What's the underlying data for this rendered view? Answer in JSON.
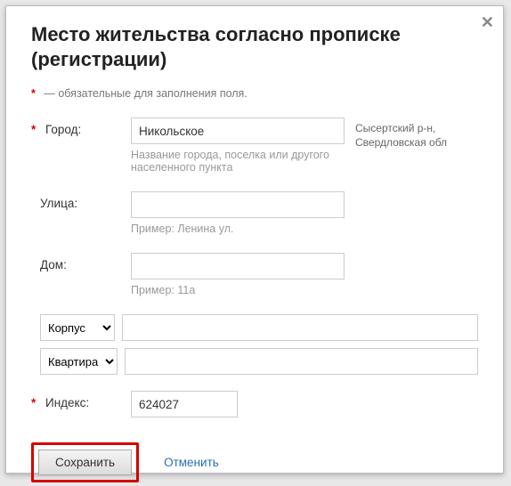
{
  "title": "Место жительства согласно прописке (регистрации)",
  "required_note": "— обязательные для заполнения поля.",
  "labels": {
    "city": "Город:",
    "street": "Улица:",
    "house": "Дом:",
    "index": "Индекс:"
  },
  "values": {
    "city": "Никольское",
    "street": "",
    "house": "",
    "korpus": "",
    "kvartira": "",
    "index": "624027"
  },
  "hints": {
    "city": "Название города, поселка или другого населенного пункта",
    "street": "Пример: Ленина ул.",
    "house": "Пример: 11а"
  },
  "side": {
    "region": "Сысертский р-н, Свердловская обл"
  },
  "selects": {
    "korpus": {
      "label": "Корпус",
      "options": [
        "Корпус"
      ]
    },
    "kvartira": {
      "label": "Квартира",
      "options": [
        "Квартира"
      ]
    }
  },
  "buttons": {
    "save": "Сохранить",
    "cancel": "Отменить"
  }
}
